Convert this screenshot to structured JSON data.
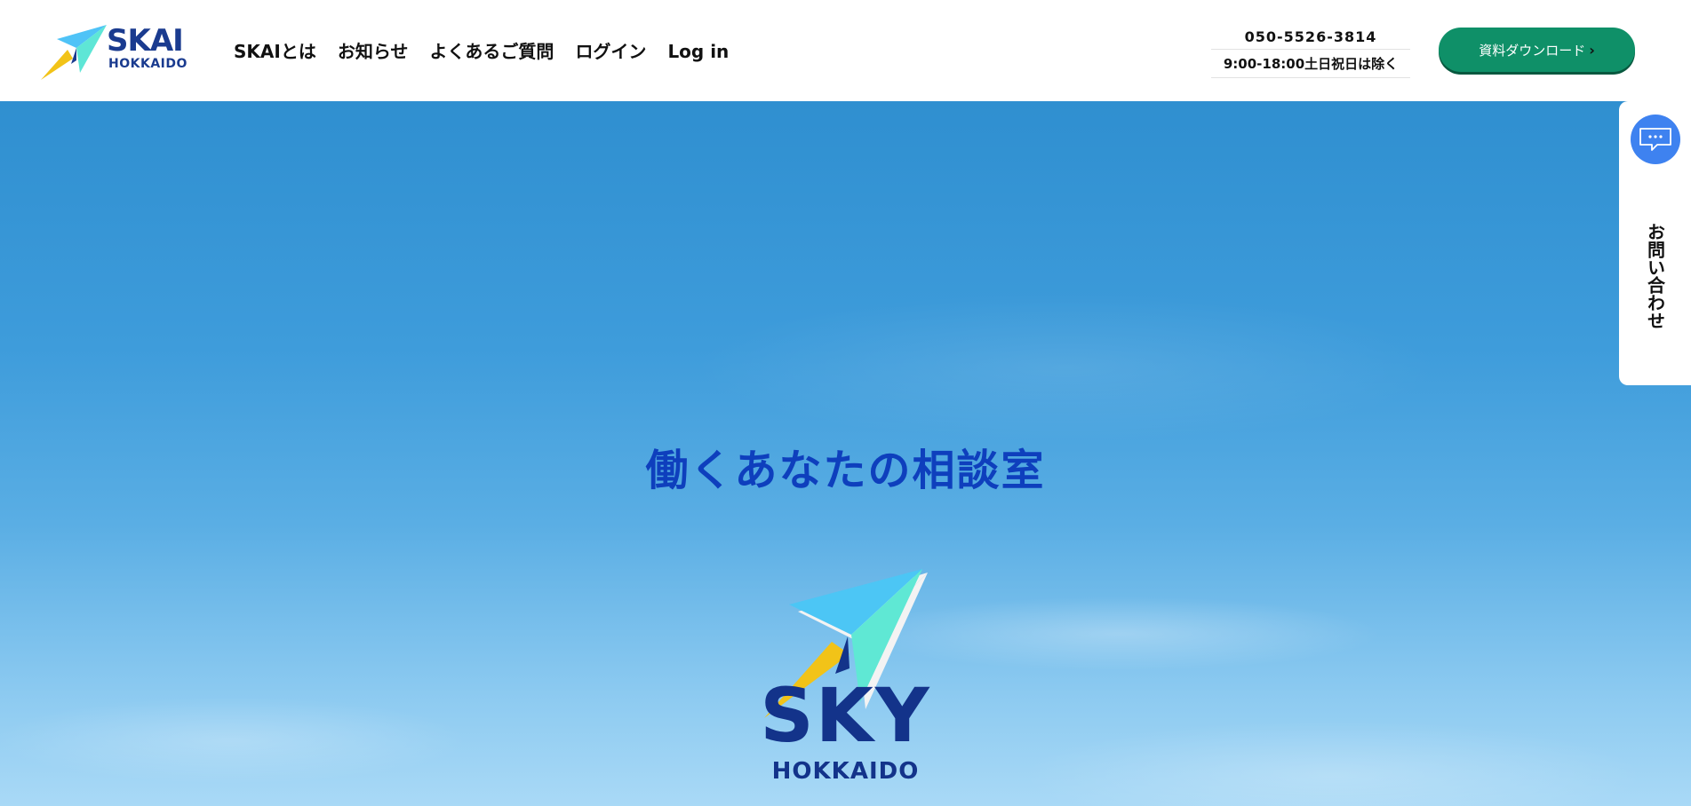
{
  "header": {
    "logo": {
      "brand": "SKAI",
      "sub": "HOKKAIDO"
    },
    "nav": [
      {
        "label": "SKAIとは"
      },
      {
        "label": "お知らせ"
      },
      {
        "label": "よくあるご質問"
      },
      {
        "label": "ログイン"
      },
      {
        "label": "Log in"
      }
    ],
    "phone": "050-5526-3814",
    "hours": "9:00-18:00土日祝日は除く",
    "download_button": "資料ダウンロード"
  },
  "hero": {
    "tagline": "働くあなたの相談室",
    "logo_brand": "SKY",
    "logo_sub": "HOKKAIDO"
  },
  "side_tab": {
    "label": "お問い合わせ",
    "icon": "chat-bubble-icon"
  },
  "colors": {
    "brand_navy": "#1a3b8f",
    "download_green": "#0f9068",
    "tagline_blue": "#0e3fbd",
    "inquiry_icon_blue": "#3e82f0"
  }
}
